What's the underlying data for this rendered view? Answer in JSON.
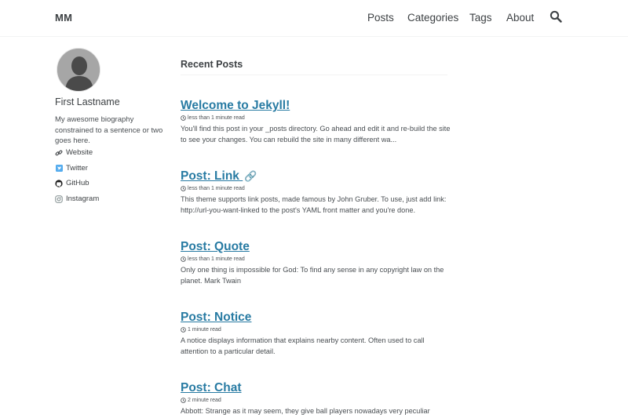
{
  "header": {
    "site_title": "MM",
    "nav": [
      "Posts",
      "Categories",
      "Tags",
      "About"
    ],
    "search_icon": "search-icon"
  },
  "sidebar": {
    "author_name": "First Lastname",
    "bio": "My awesome biography constrained to a sentence or two goes here.",
    "links": [
      {
        "label": "Website",
        "icon": "link-icon"
      },
      {
        "label": "Twitter",
        "icon": "twitter-icon"
      },
      {
        "label": "GitHub",
        "icon": "github-icon"
      },
      {
        "label": "Instagram",
        "icon": "instagram-icon"
      }
    ]
  },
  "main": {
    "section_title": "Recent Posts",
    "posts": [
      {
        "title": "Welcome to Jekyll!",
        "read_time": "less than 1 minute read",
        "excerpt": "You'll find this post in your _posts directory. Go ahead and edit it and re-build the site to see your changes. You can rebuild the site in many different wa..."
      },
      {
        "title": "Post: Link",
        "title_suffix": "🔗",
        "read_time": "less than 1 minute read",
        "excerpt": "This theme supports link posts, made famous by John Gruber. To use, just add link: http://url-you-want-linked to the post's YAML front matter and you're done."
      },
      {
        "title": "Post: Quote",
        "read_time": "less than 1 minute read",
        "excerpt": "Only one thing is impossible for God: To find any sense in any copyright law on the planet. Mark Twain"
      },
      {
        "title": "Post: Notice",
        "read_time": "1 minute read",
        "excerpt": "A notice displays information that explains nearby content. Often used to call attention to a particular detail."
      },
      {
        "title": "Post: Chat",
        "read_time": "2 minute read",
        "excerpt": "Abbott: Strange as it may seem, they give ball players nowadays very peculiar names."
      }
    ]
  },
  "colors": {
    "link": "#287ba3",
    "text": "#494e52",
    "heading": "#3d4144"
  }
}
